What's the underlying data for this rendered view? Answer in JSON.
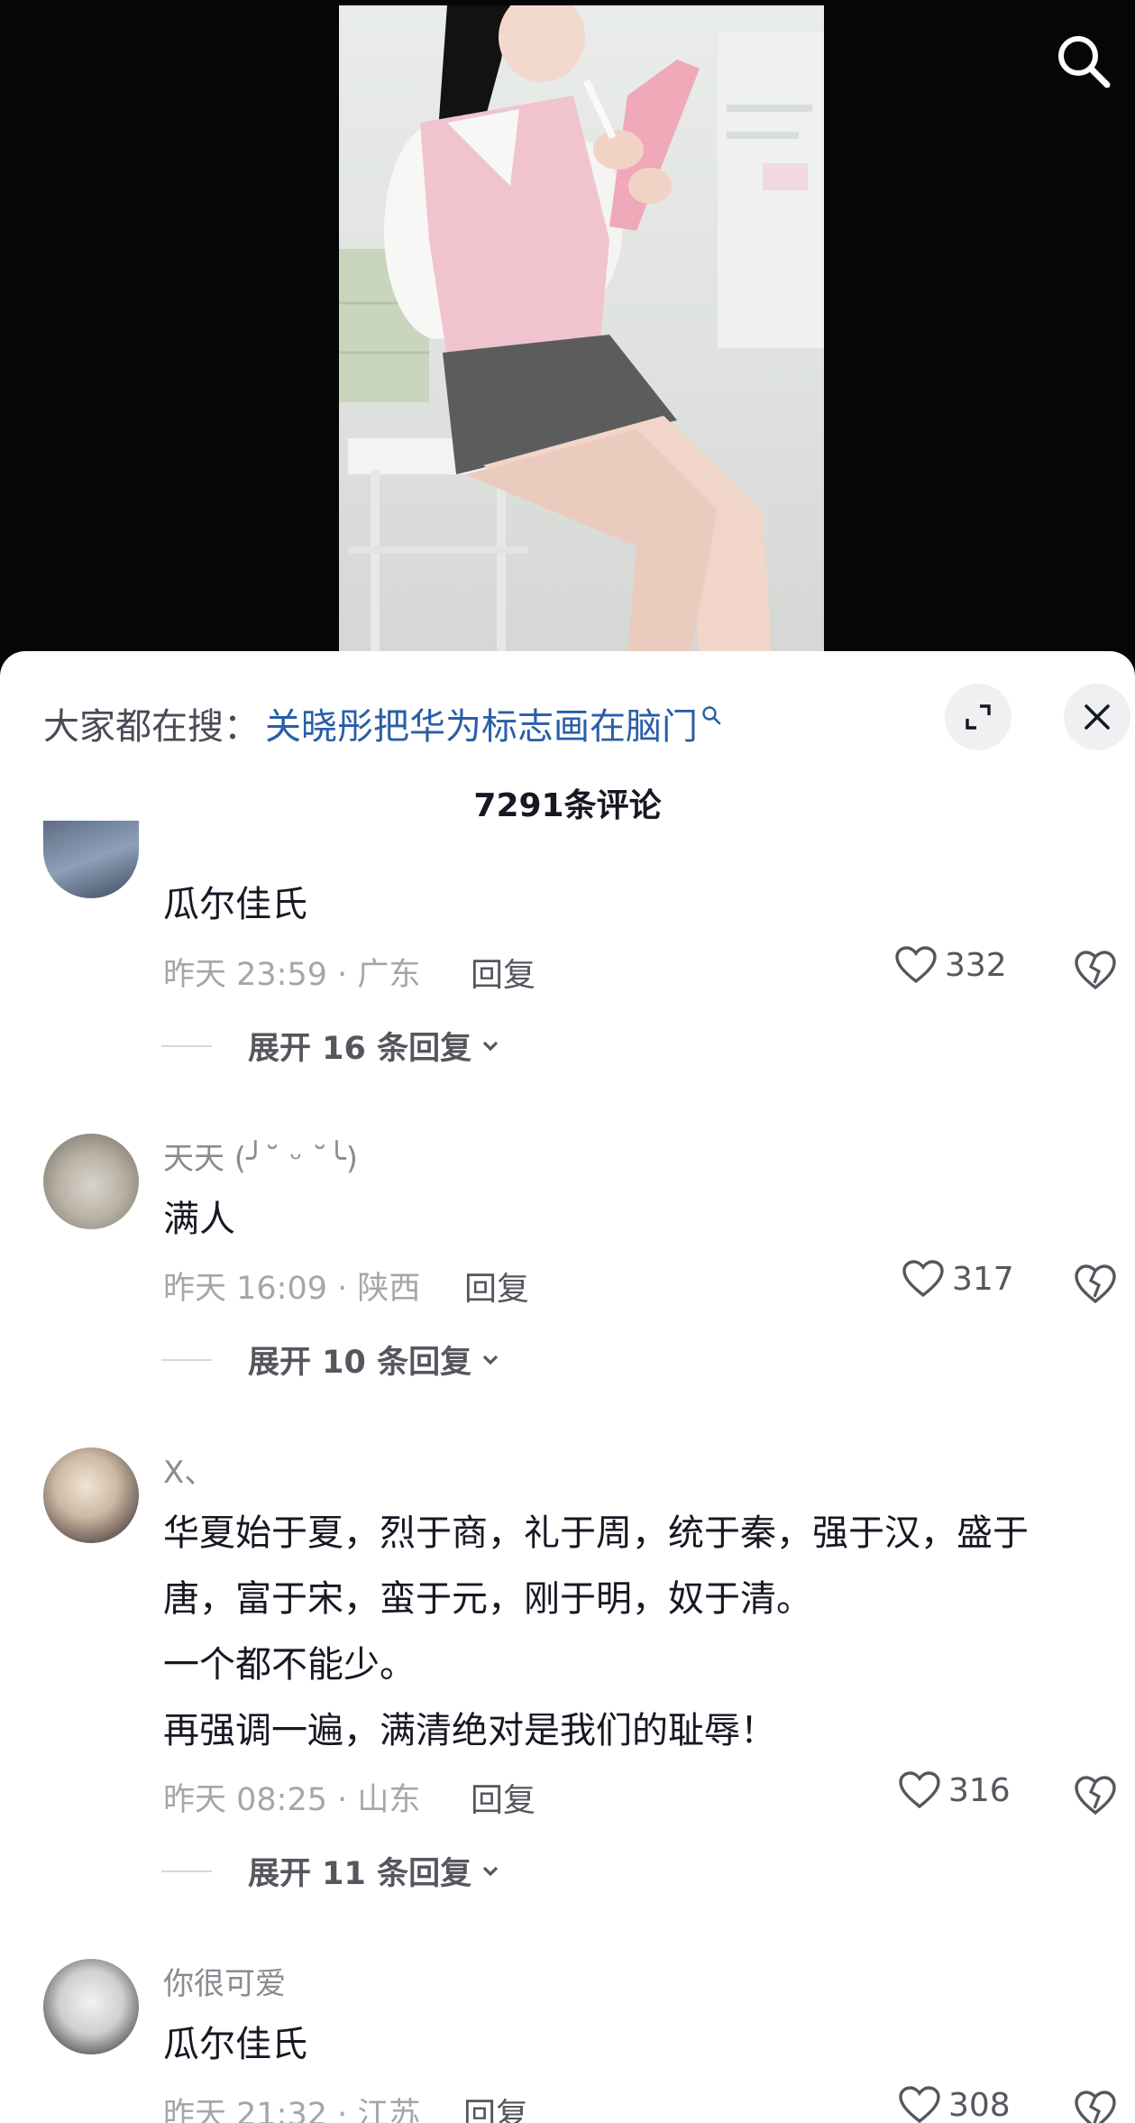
{
  "search": {
    "prefix": "大家都在搜：",
    "query": "关晓彤把华为标志画在脑门"
  },
  "comment_count": "7291条评论",
  "comments": [
    {
      "username": "",
      "text": [
        "瓜尔佳氏"
      ],
      "time": "昨天 23:59 · 广东",
      "reply": "回复",
      "likes": "332",
      "expand": "展开 16 条回复"
    },
    {
      "username": "天天 (╯˘ ᵕ ˘╰)",
      "text": [
        "满人"
      ],
      "time": "昨天 16:09 · 陕西",
      "reply": "回复",
      "likes": "317",
      "expand": "展开 10 条回复"
    },
    {
      "username": "X、",
      "text": [
        "华夏始于夏，烈于商，礼于周，统于秦，强于汉，盛于",
        "唐，富于宋，蛮于元，刚于明，奴于清。",
        "一个都不能少。",
        "再强调一遍，满清绝对是我们的耻辱！"
      ],
      "time": "昨天 08:25 · 山东",
      "reply": "回复",
      "likes": "316",
      "expand": "展开 11 条回复"
    },
    {
      "username": "你很可爱",
      "text": [
        "瓜尔佳氏"
      ],
      "time": "昨天 21:32 · 江苏",
      "reply": "回复",
      "likes": "308"
    }
  ],
  "icons": {
    "search": "search-icon",
    "expand": "expand-icon",
    "close": "close-icon",
    "like": "heart-icon",
    "dislike": "broken-heart-icon",
    "chevron": "chevron-down-icon"
  },
  "colors": {
    "search_link": "#2a5ea8",
    "sheet_bg": "#ffffff",
    "video_bg": "#060606"
  }
}
